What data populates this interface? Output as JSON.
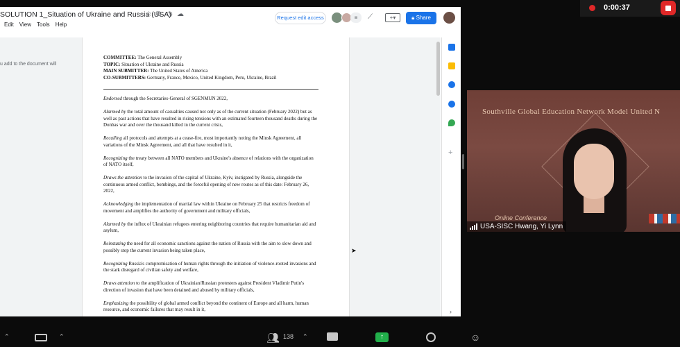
{
  "doc": {
    "title": "SOLUTION 1_Situation of Ukraine and Russia (USA)",
    "menu": [
      "Edit",
      "View",
      "Tools",
      "Help"
    ],
    "request_edit": "Request edit access",
    "share": "Share",
    "side_note": "u add to the document will"
  },
  "content": {
    "header": [
      {
        "label": "COMMITTEE:",
        "value": " The General Assembly"
      },
      {
        "label": "TOPIC:",
        "value": " Situation of Ukraine and Russia"
      },
      {
        "label": "MAIN SUBMITTER:",
        "value": " The United States of America"
      },
      {
        "label": "CO-SUBMITTERS:",
        "value": " Germany, France, Mexico, United Kingdom, Peru, Ukraine, Brazil"
      }
    ],
    "clauses": [
      {
        "lead": "Endorsed",
        "text": " through the Secretaries-General of SGENMUN 2022,"
      },
      {
        "lead": "Alarmed by",
        "text": " the total amount of casualties caused not only as of the current situation (February 2022) but as well as past actions that have resulted in rising tensions with an estimated fourteen thousand deaths during the Donbas war and over the thousand killed in the current crisis,"
      },
      {
        "lead": "Recalling",
        "text": " all protocols and attempts at a cease-fire, most importantly noting the Minsk Agreement, all variations of the Minsk Agreement, and all that have resulted in it,"
      },
      {
        "lead": "Recognizing",
        "text": " the treaty between all NATO members and Ukraine's absence of relations with the organization of NATO itself,"
      },
      {
        "lead": "Draws the attention",
        "text": " to the invasion of the capital of Ukraine, Kyiv, instigated by Russia, alongside the continuous armed conflict, bombings, and the forceful opening of new routes as of this date: February 26, 2022,"
      },
      {
        "lead": "Acknowledging",
        "text": " the implementation of martial law within Ukraine on February 25 that restricts freedom of movement and amplifies the authority of government and military officials,"
      },
      {
        "lead": "Alarmed by",
        "text": " the influx of Ukrainian refugees entering neighboring countries that require humanitarian aid and asylum,"
      },
      {
        "lead": "Reinstating",
        "text": " the need for all economic sanctions against the nation of Russia with the aim to slow down and possibly stop the current invasion being taken place,"
      },
      {
        "lead": "Recognizing",
        "text": " Russia's compromisation of human rights through the initiation of violence-rooted invasions and the stark disregard of civilian safety and welfare,"
      },
      {
        "lead": "Draws attention",
        "text": " to the amplification of Ukrainian/Russian protesters against President Vladimir Putin's direction of invasion that have been detained and abused by military officials,"
      },
      {
        "lead": "Emphasizing",
        "text": " the possibility of global armed conflict beyond the continent of Europe and all harm, human resource, and economic failures that may result in it,"
      }
    ]
  },
  "zoom": {
    "recording_time": "0:00:37",
    "participant_name": "USA-SISC Hwang, Yi Lynn",
    "background_banner": "Southville Global Education Network Model United N",
    "background_sub": "Online Conference",
    "participants_count": "138"
  },
  "colors": {
    "share_blue": "#1a73e8",
    "record_red": "#e02828",
    "share_green": "#22b04b"
  }
}
